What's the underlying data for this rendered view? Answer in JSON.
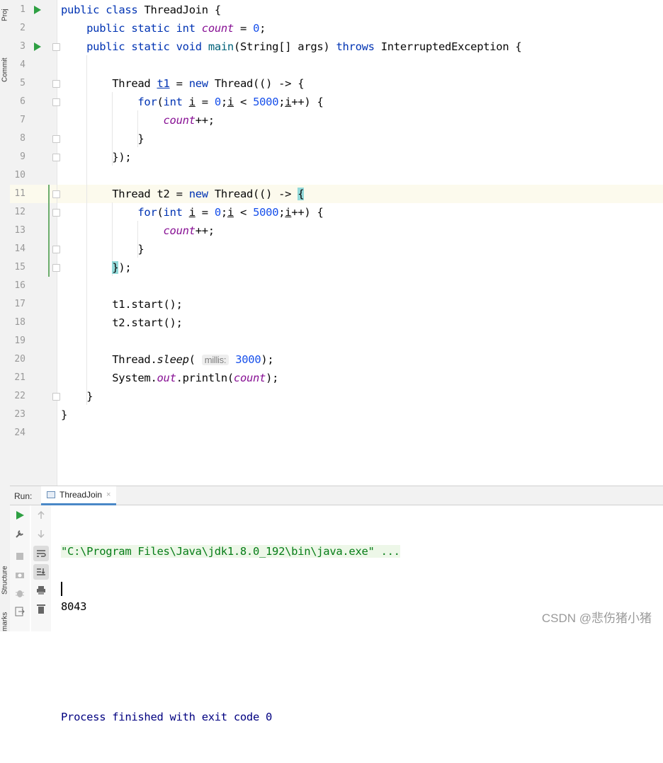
{
  "tool_strip": {
    "project_label": "Proj",
    "commit_label": "Commit",
    "structure_label": "Structure",
    "bookmarks_label": "marks"
  },
  "editor": {
    "line_numbers": [
      "1",
      "2",
      "3",
      "4",
      "5",
      "6",
      "7",
      "8",
      "9",
      "10",
      "11",
      "12",
      "13",
      "14",
      "15",
      "16",
      "17",
      "18",
      "19",
      "20",
      "21",
      "22",
      "23",
      "24"
    ],
    "tokens": {
      "public": "public",
      "class": "class",
      "class_name": "ThreadJoin",
      "brace_open": "{",
      "brace_close": "}",
      "static": "static",
      "int": "int",
      "count": "count",
      "assign_zero": " = ",
      "zero": "0",
      "semi": ";",
      "void": "void",
      "main": "main",
      "params": "(String[] args) ",
      "throws": "throws",
      "exception": " InterruptedException {",
      "thread_type": "Thread ",
      "t1": "t1",
      "t2": "t2",
      "eq": " = ",
      "new": "new",
      "lambda": " Thread(() -> ",
      "for": "for",
      "for_open": "(",
      "i": "i",
      "for_mid": " = ",
      "lt": " < ",
      "limit": "5000",
      "inc": "++) {",
      "count_inc": "++;",
      "close_lambda_brace": "}",
      "close_lambda_rest": ");",
      "t1_start": "t1.start();",
      "t2_start": "t2.start();",
      "thread_dot": "Thread.",
      "sleep": "sleep",
      "paren_open": "(",
      "hint": "millis:",
      "sleep_value": "3000",
      "sleep_end": ");",
      "system_dot": "System.",
      "out": "out",
      "println": ".println(",
      "println_end": ");"
    }
  },
  "run_panel": {
    "label": "Run:",
    "tab": "ThreadJoin",
    "tab_close": "×",
    "command": "\"C:\\Program Files\\Java\\jdk1.8.0_192\\bin\\java.exe\" ...",
    "output": "8043",
    "finished": "Process finished with exit code 0"
  },
  "watermark": "CSDN @悲伤猪小猪",
  "colors": {
    "keyword": "#0033b3",
    "number": "#1750eb",
    "field": "#871094",
    "run_green": "#2ea043",
    "bracket_highlight": "#93d9d9"
  }
}
